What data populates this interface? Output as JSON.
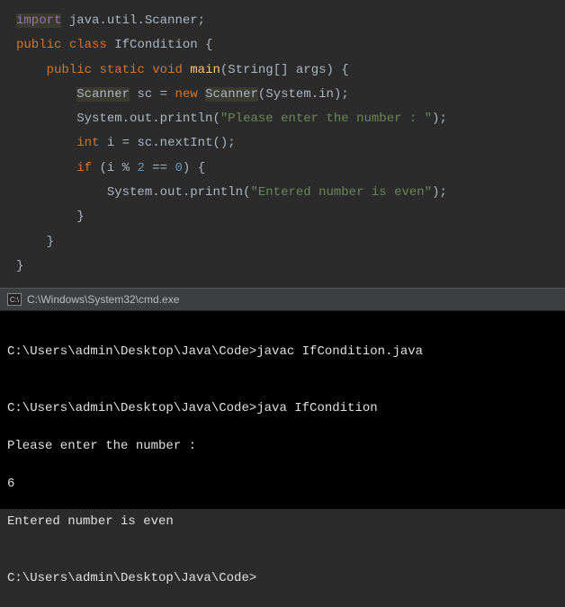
{
  "code": {
    "tokens": {
      "import": "import",
      "public": "public",
      "class": "class",
      "static": "static",
      "void": "void",
      "new": "new",
      "int": "int",
      "if": "if",
      "package": "java.util.Scanner",
      "class_name": "IfCondition",
      "main": "main",
      "main_args": "String[] args",
      "scanner_type": "Scanner",
      "sc_var": "sc",
      "system_in": "System.in",
      "println1_call": "System.out.println",
      "string1": "\"Please enter the number : \"",
      "i_var": "i",
      "nextint_call": "sc.nextInt",
      "cond_lhs": "i",
      "mod": "%",
      "two": "2",
      "eq": "==",
      "zero": "0",
      "println2_call": "System.out.println",
      "string2": "\"Entered number is even\""
    }
  },
  "terminal_bar": {
    "title": "C:\\Windows\\System32\\cmd.exe"
  },
  "terminal": {
    "lines": {
      "l1": "C:\\Users\\admin\\Desktop\\Java\\Code>javac IfCondition.java",
      "l2": "",
      "l3": "C:\\Users\\admin\\Desktop\\Java\\Code>java IfCondition",
      "l4": "Please enter the number :",
      "l5": "6",
      "l6": "Entered number is even",
      "l7": "",
      "l8": "C:\\Users\\admin\\Desktop\\Java\\Code>"
    }
  }
}
